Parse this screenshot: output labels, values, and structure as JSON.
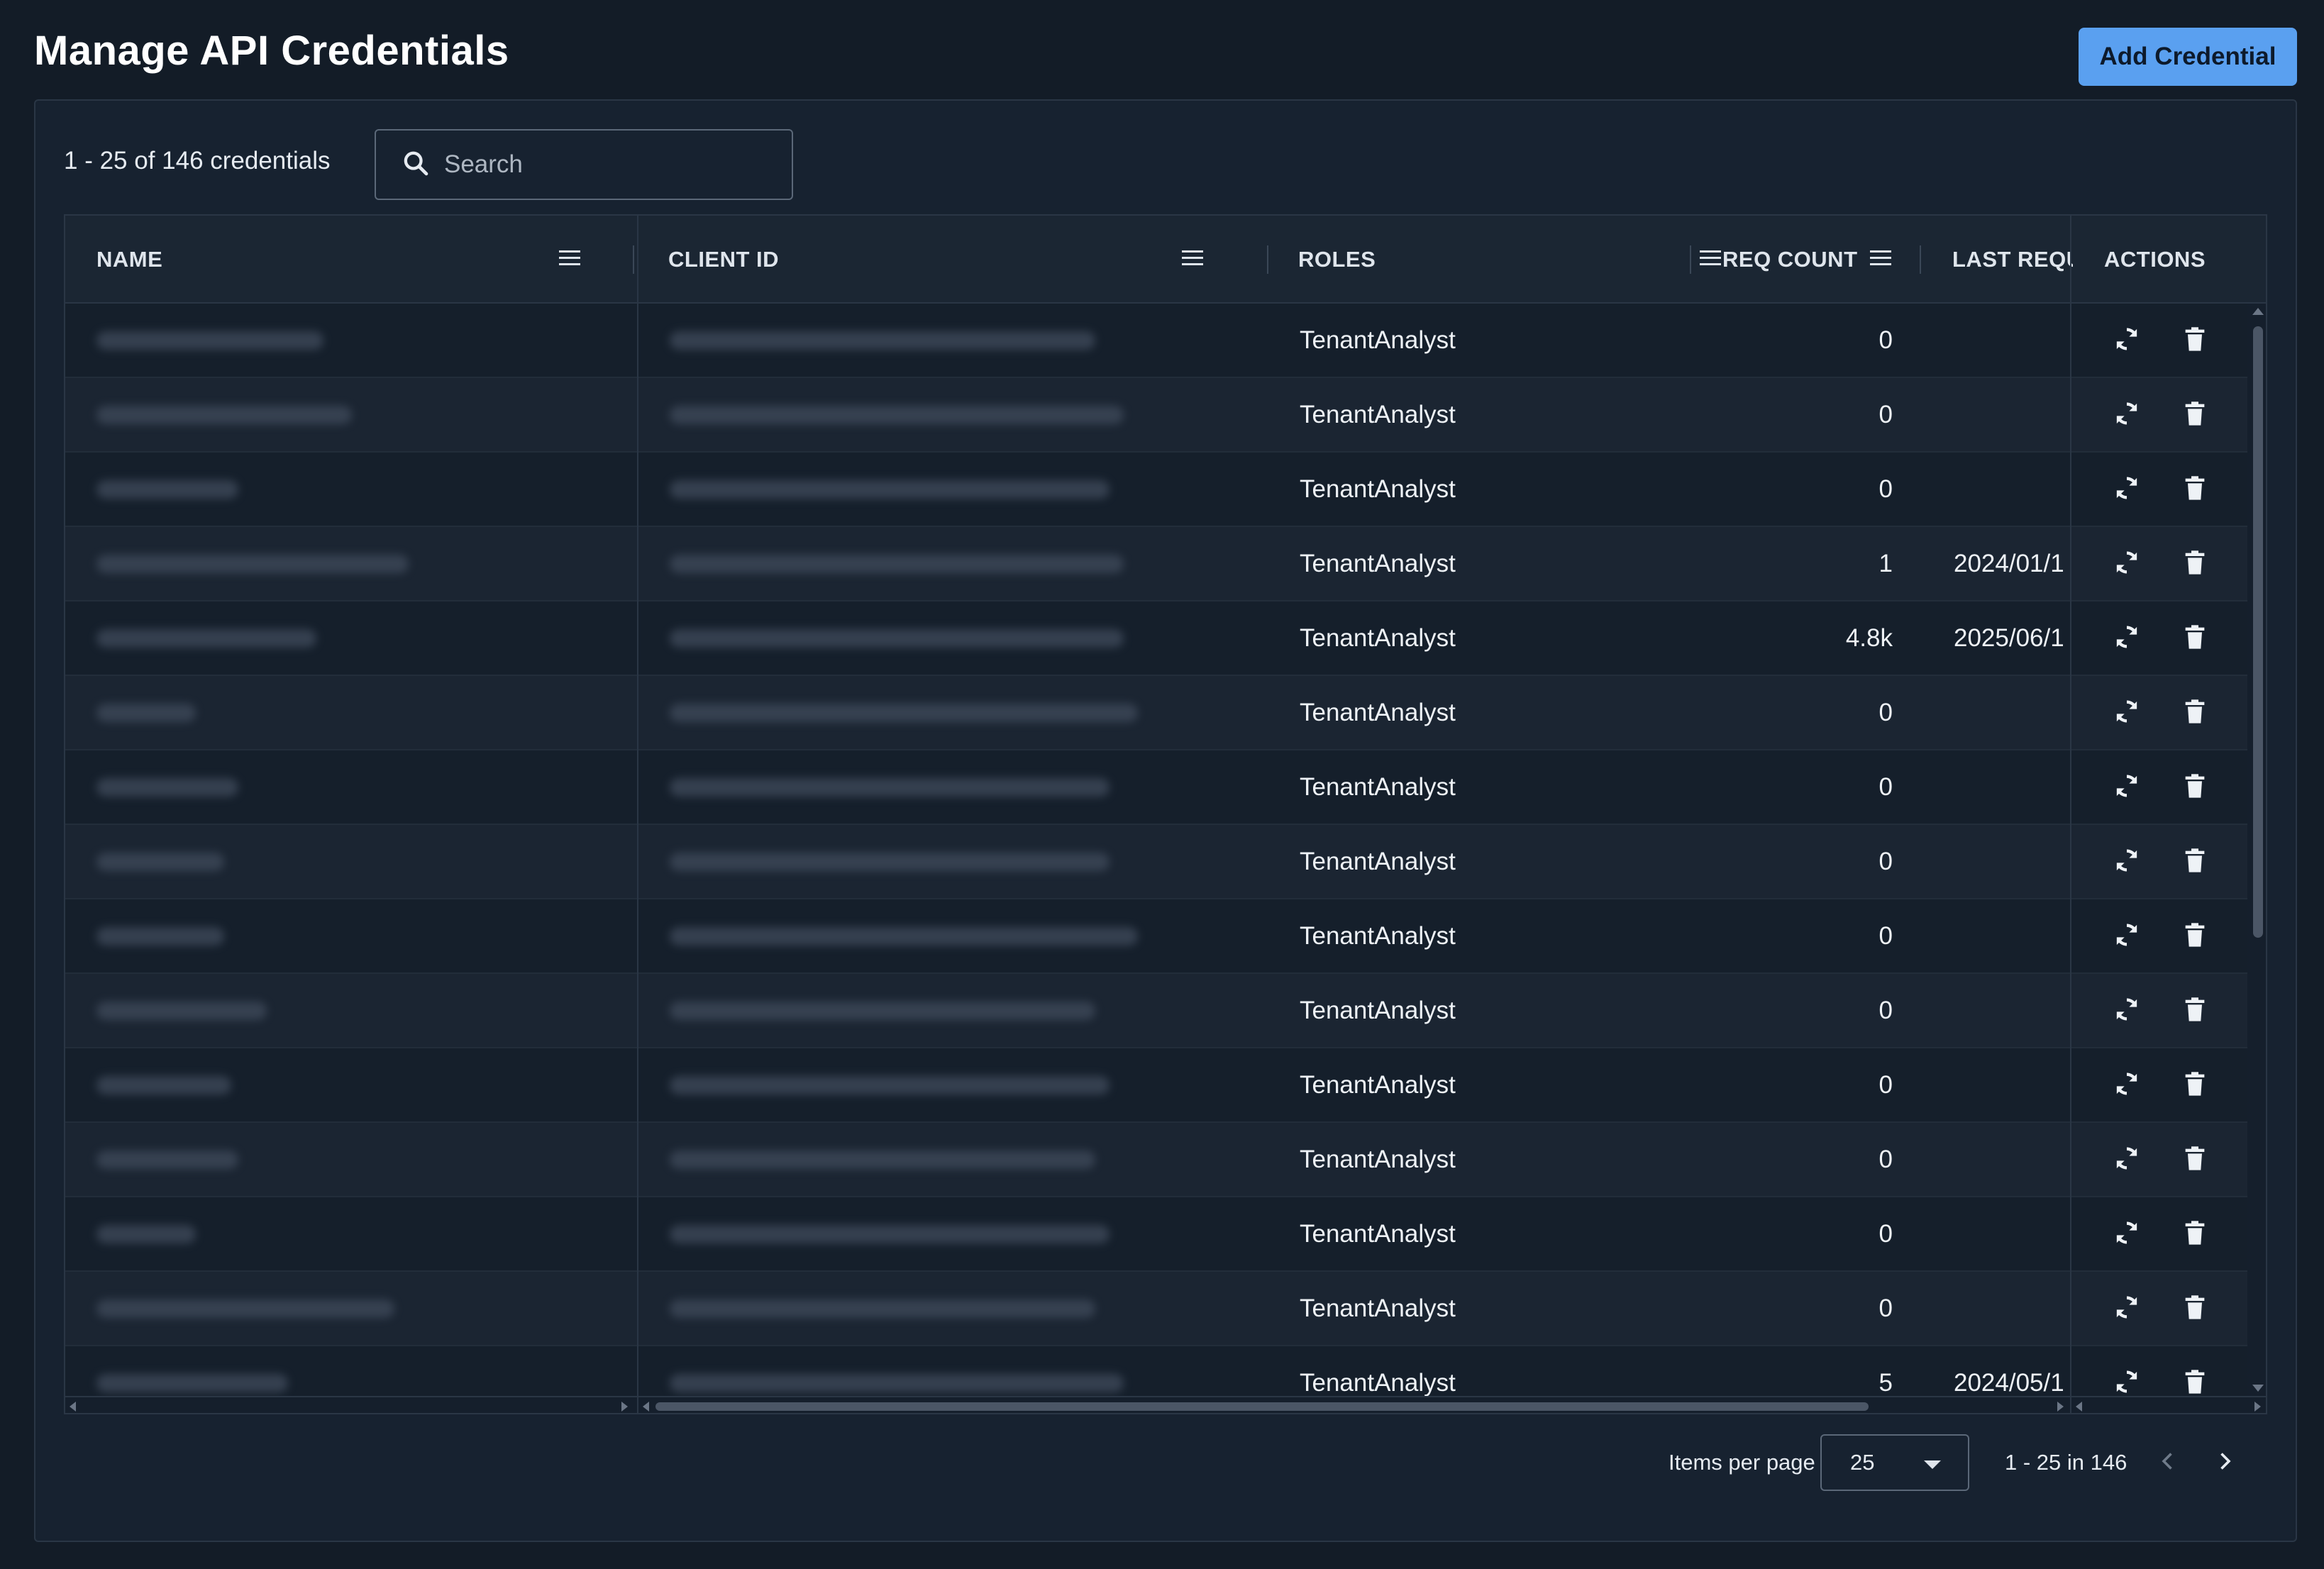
{
  "header": {
    "title": "Manage API Credentials",
    "add_button": "Add Credential"
  },
  "toolbar": {
    "count_label": "1 - 25 of 146 credentials",
    "search_placeholder": "Search"
  },
  "columns": {
    "name": "NAME",
    "client_id": "CLIENT ID",
    "roles": "ROLES",
    "req_count": "REQ COUNT",
    "last_request": "LAST REQU",
    "actions": "ACTIONS"
  },
  "rows": [
    {
      "role": "TenantAnalyst",
      "req_count": "0",
      "last_request": ""
    },
    {
      "role": "TenantAnalyst",
      "req_count": "0",
      "last_request": ""
    },
    {
      "role": "TenantAnalyst",
      "req_count": "0",
      "last_request": ""
    },
    {
      "role": "TenantAnalyst",
      "req_count": "1",
      "last_request": "2024/01/1"
    },
    {
      "role": "TenantAnalyst",
      "req_count": "4.8k",
      "last_request": "2025/06/1"
    },
    {
      "role": "TenantAnalyst",
      "req_count": "0",
      "last_request": ""
    },
    {
      "role": "TenantAnalyst",
      "req_count": "0",
      "last_request": ""
    },
    {
      "role": "TenantAnalyst",
      "req_count": "0",
      "last_request": ""
    },
    {
      "role": "TenantAnalyst",
      "req_count": "0",
      "last_request": ""
    },
    {
      "role": "TenantAnalyst",
      "req_count": "0",
      "last_request": ""
    },
    {
      "role": "TenantAnalyst",
      "req_count": "0",
      "last_request": ""
    },
    {
      "role": "TenantAnalyst",
      "req_count": "0",
      "last_request": ""
    },
    {
      "role": "TenantAnalyst",
      "req_count": "0",
      "last_request": ""
    },
    {
      "role": "TenantAnalyst",
      "req_count": "0",
      "last_request": ""
    },
    {
      "role": "TenantAnalyst",
      "req_count": "5",
      "last_request": "2024/05/1"
    }
  ],
  "pagination": {
    "items_per_page_label": "Items per page",
    "items_per_page_value": "25",
    "range_label": "1 - 25 in 146"
  },
  "colors": {
    "accent": "#5aa0f0",
    "background": "#131c27",
    "card": "#172230"
  },
  "icons": [
    "search-icon",
    "column-menu-icon",
    "regenerate-icon",
    "trash-icon",
    "chevron-left-icon",
    "chevron-right-icon",
    "dropdown-caret-icon"
  ]
}
